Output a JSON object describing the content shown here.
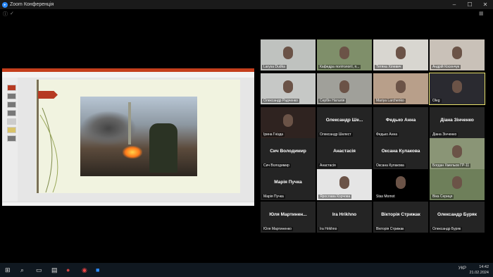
{
  "window": {
    "title": "Zoom Конференція",
    "min": "–",
    "max": "☐",
    "close": "✕"
  },
  "tiles": [
    {
      "id": "t1",
      "name": "Larysa Dudka",
      "type": "video",
      "bg": "#bfc2bf"
    },
    {
      "id": "t2",
      "name": "Кафедра політології, п...",
      "type": "video",
      "bg": "#7f8f6a"
    },
    {
      "id": "t3",
      "name": "Тетяна Хілевич",
      "type": "video",
      "bg": "#d8d6d0"
    },
    {
      "id": "t4",
      "name": "Андрій Косенчук",
      "type": "video",
      "bg": "#c9c1b8"
    },
    {
      "id": "t5",
      "name": "Олександр Радченко",
      "type": "video",
      "bg": "#c6c8c6"
    },
    {
      "id": "t6",
      "name": "Сербін Наталія",
      "type": "video",
      "bg": "#a0a09a"
    },
    {
      "id": "t7",
      "name": "Mariya Larchenko",
      "type": "video",
      "bg": "#b89f8a"
    },
    {
      "id": "t8",
      "name": "Oleg",
      "type": "video",
      "bg": "#2a2a30",
      "active": true
    },
    {
      "id": "t9",
      "name": "Ірина Гнізда",
      "type": "video",
      "bg": "#2f2320"
    },
    {
      "id": "t10",
      "name": "Олександр Шелест",
      "display": "Олександр Ше...",
      "type": "name"
    },
    {
      "id": "t11",
      "name": "Федько Анна",
      "display": "Федько Анна",
      "type": "name"
    },
    {
      "id": "t12",
      "name": "Діана Зінченко",
      "display": "Діана Зінченко",
      "type": "name"
    },
    {
      "id": "t13",
      "name": "Сич Володимир",
      "display": "Сич Володимир",
      "type": "name"
    },
    {
      "id": "t14",
      "name": "Анастасія",
      "display": "Анастасія",
      "type": "name"
    },
    {
      "id": "t15",
      "name": "Оксана Кулакова",
      "display": "Оксана Кулакова",
      "type": "name"
    },
    {
      "id": "t16",
      "name": "Богдан Хмельов ГР-11",
      "type": "video",
      "bg": "#8a9576"
    },
    {
      "id": "t17",
      "name": "Марія Пучка",
      "display": "Марія Пучка",
      "type": "name"
    },
    {
      "id": "t18",
      "name": "Ярослава Корчова",
      "type": "video",
      "bg": "#e5e5e5"
    },
    {
      "id": "t19",
      "name": "Stas Momot",
      "type": "video",
      "bg": "#000000"
    },
    {
      "id": "t20",
      "name": "Віка Сериця",
      "type": "video",
      "bg": "#6e7f5a"
    },
    {
      "id": "t21",
      "name": "Юля Мартиненко",
      "display": "Юля Мартинен...",
      "type": "name"
    },
    {
      "id": "t22",
      "name": "Ira Hrikhno",
      "display": "Ira Hrikhno",
      "type": "name"
    },
    {
      "id": "t23",
      "name": "Вікторія Стрижак",
      "display": "Вікторія Стрижак",
      "type": "name"
    },
    {
      "id": "t24",
      "name": "Олександр Буряк",
      "display": "Олександр Буряк",
      "type": "name"
    }
  ],
  "taskbar": {
    "lang": "УКР",
    "time": "14:42",
    "date": "21.02.2024"
  }
}
